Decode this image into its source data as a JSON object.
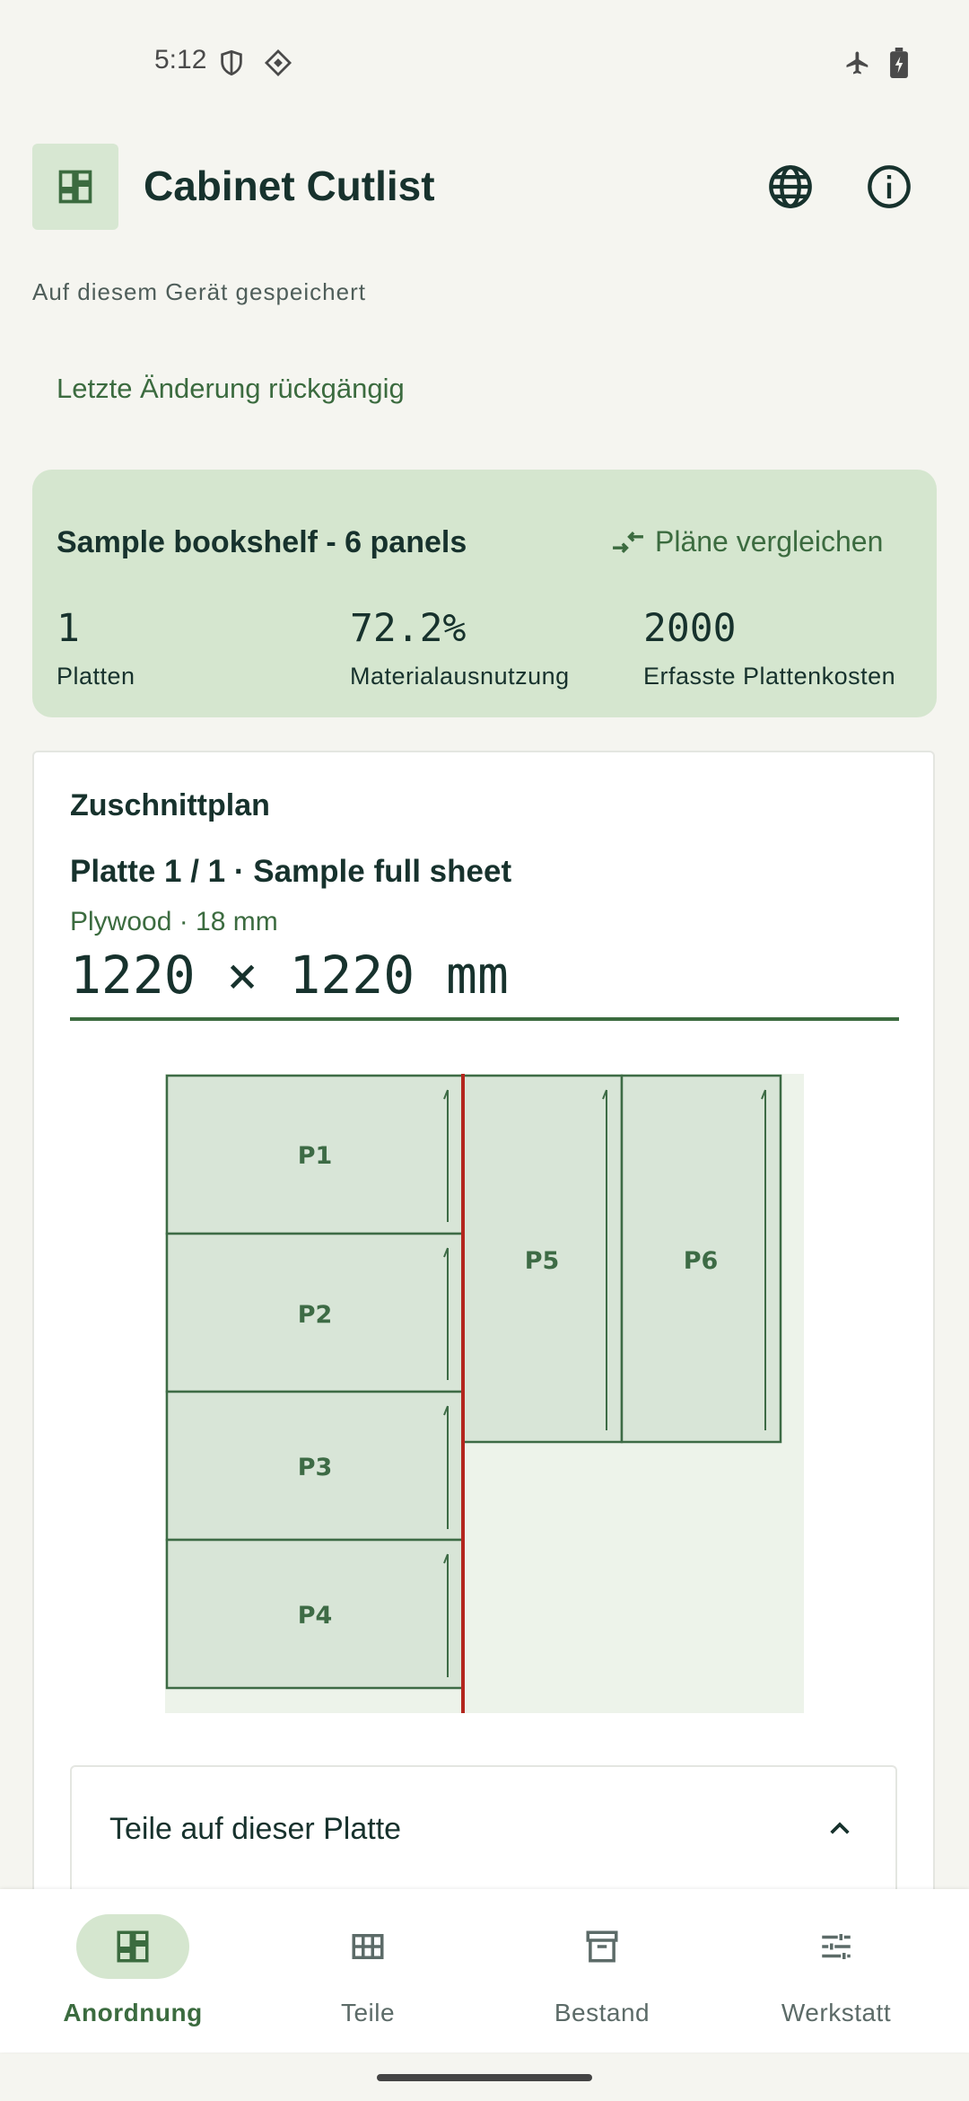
{
  "status": {
    "time": "5:12"
  },
  "app": {
    "title": "Cabinet Cutlist"
  },
  "saved_text": "Auf diesem Gerät gespeichert",
  "undo_label": "Letzte Änderung rückgängig",
  "summary": {
    "title": "Sample bookshelf - 6 panels",
    "compare_label": "Pläne vergleichen",
    "stats": [
      {
        "value": "1",
        "label": "Platten"
      },
      {
        "value": "72.2%",
        "label": "Materialausnutzung"
      },
      {
        "value": "2000",
        "label": "Erfasste Plattenkosten"
      }
    ]
  },
  "plan": {
    "title": "Zuschnittplan",
    "sheet_title": "Platte 1 / 1 · Sample full sheet",
    "sheet_sub": "Plywood · 18 mm",
    "dimensions": "1220 × 1220 mm",
    "panels": [
      "P1",
      "P2",
      "P3",
      "P4",
      "P5",
      "P6"
    ],
    "parts_title": "Teile auf dieser Platte"
  },
  "nav": {
    "items": [
      {
        "label": "Anordnung",
        "icon": "dashboard-icon",
        "active": true
      },
      {
        "label": "Teile",
        "icon": "grid-icon",
        "active": false
      },
      {
        "label": "Bestand",
        "icon": "archive-icon",
        "active": false
      },
      {
        "label": "Werkstatt",
        "icon": "tune-icon",
        "active": false
      }
    ]
  },
  "colors": {
    "accent": "#3b6b3f",
    "summary_bg": "#d5e6cf",
    "panel_fill": "#d8e5d7",
    "cut_line": "#b3261e"
  }
}
